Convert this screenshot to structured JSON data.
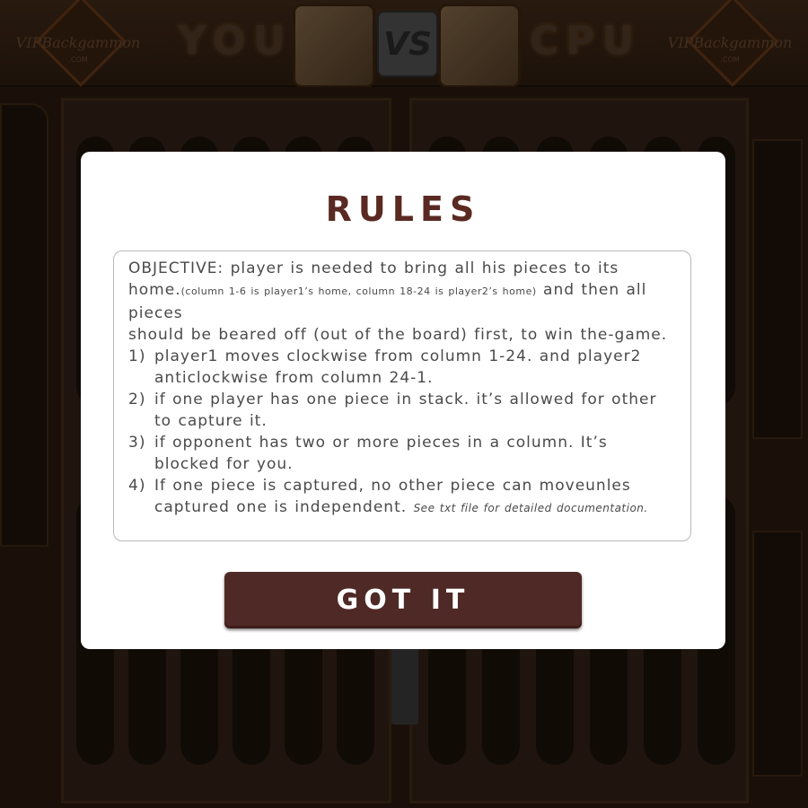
{
  "header": {
    "logo_text": "VIPBackgammon",
    "logo_sub": ".COM",
    "player1_name": "YOU",
    "player2_name": "CPU",
    "vs_label": "VS"
  },
  "modal": {
    "title": "RULES",
    "objective_lead": "OBJECTIVE: player is needed to bring all his pieces to its home.",
    "objective_small": "(column 1-6 is player1’s home, column 18-24 is player2’s home)",
    "objective_tail": " and then all pieces",
    "objective_line2": "should be beared off (out of the board) first, to win the-game.",
    "rules": [
      {
        "num": "1)",
        "text": "player1 moves clockwise from column 1-24. and player2 anticlockwise from column 24-1."
      },
      {
        "num": "2)",
        "text": "if one player has one piece in stack. it’s allowed for other to capture it."
      },
      {
        "num": "3)",
        "text": "if opponent has two or more pieces in a column. It’s blocked for you."
      },
      {
        "num": "4)",
        "text": "If one piece is captured, no other piece can moveunles captured one is independent."
      }
    ],
    "footnote": "See txt file for detailed documentation.",
    "button_label": "GOT IT"
  }
}
